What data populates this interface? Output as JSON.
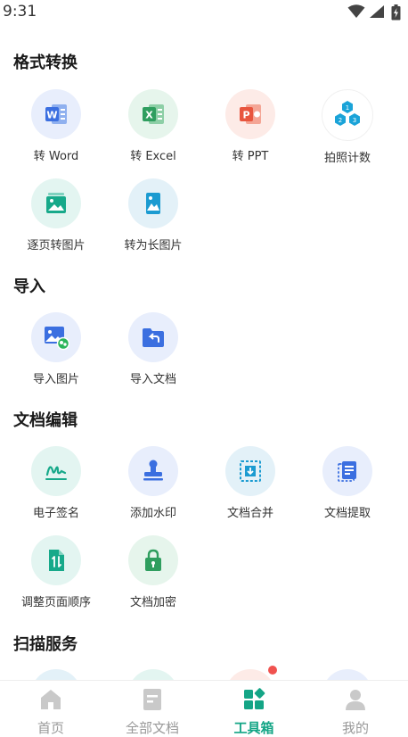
{
  "status_bar": {
    "time": "9:31"
  },
  "sections": [
    {
      "title": "格式转换",
      "tools": [
        {
          "label": "转 Word",
          "icon": "word-icon"
        },
        {
          "label": "转 Excel",
          "icon": "excel-icon"
        },
        {
          "label": "转 PPT",
          "icon": "ppt-icon"
        },
        {
          "label": "拍照计数",
          "icon": "count-icon"
        },
        {
          "label": "逐页转图片",
          "icon": "page-to-image-icon"
        },
        {
          "label": "转为长图片",
          "icon": "long-image-icon"
        }
      ]
    },
    {
      "title": "导入",
      "tools": [
        {
          "label": "导入图片",
          "icon": "import-image-icon"
        },
        {
          "label": "导入文档",
          "icon": "import-document-icon"
        }
      ]
    },
    {
      "title": "文档编辑",
      "tools": [
        {
          "label": "电子签名",
          "icon": "signature-icon"
        },
        {
          "label": "添加水印",
          "icon": "watermark-stamp-icon"
        },
        {
          "label": "文档合并",
          "icon": "merge-icon"
        },
        {
          "label": "文档提取",
          "icon": "extract-icon"
        },
        {
          "label": "调整页面顺序",
          "icon": "reorder-pages-icon"
        },
        {
          "label": "文档加密",
          "icon": "lock-icon"
        }
      ]
    },
    {
      "title": "扫描服务",
      "tools": []
    }
  ],
  "tabbar": {
    "items": [
      {
        "label": "首页",
        "icon": "home-icon",
        "active": false
      },
      {
        "label": "全部文档",
        "icon": "documents-icon",
        "active": false
      },
      {
        "label": "工具箱",
        "icon": "toolbox-icon",
        "active": true
      },
      {
        "label": "我的",
        "icon": "profile-icon",
        "active": false
      }
    ]
  },
  "colors": {
    "accent": "#14a586",
    "word": "#3b6fe0",
    "excel": "#2f9e5f",
    "ppt": "#e8553e",
    "count": "#1aa3d8",
    "badge": "#f0524f"
  }
}
